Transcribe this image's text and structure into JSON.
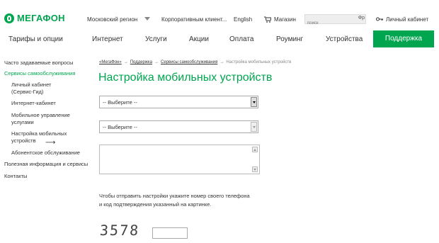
{
  "header": {
    "logo_text": "МЕГАФОН",
    "region": "Московский регион",
    "corporate": "Корпоративным клиент...",
    "language": "English",
    "shop": "Магазин",
    "search_placeholder": "поиск",
    "search_button": "Фр",
    "cabinet": "Личный кабинет"
  },
  "nav": {
    "items": [
      "Тарифы и опции",
      "Интернет",
      "Услуги",
      "Акции",
      "Оплата",
      "Роуминг",
      "Устройства"
    ],
    "active": "Поддержка"
  },
  "sidebar": {
    "items": [
      "Часто задаваемые вопросы",
      "Сервисы самообслуживания",
      "Личный кабинет",
      "(Сервис-Гид)",
      "Интернет-кабинет",
      "Мобильное управление",
      "услугами",
      "Настройка мобильных",
      "устройств",
      "Абонентское обслуживание",
      "Полезная информация и сервисы",
      "Контакты"
    ]
  },
  "breadcrumbs": {
    "items": [
      "«МегаФон»",
      "Поддержка",
      "Сервисы самообслуживания"
    ],
    "current": "Настройка мобильных устройств"
  },
  "page_title": "Настройка мобильных устройств",
  "form": {
    "select1_value": "-- Выберите --",
    "select2_value": "-- Выберите --",
    "hint_line1": "Чтобы отправить настройки укажите номер своего телефона",
    "hint_line2": "и код подтверждения указанный на картинке.",
    "captcha": "3578"
  },
  "colors": {
    "brand": "#00a64f"
  }
}
